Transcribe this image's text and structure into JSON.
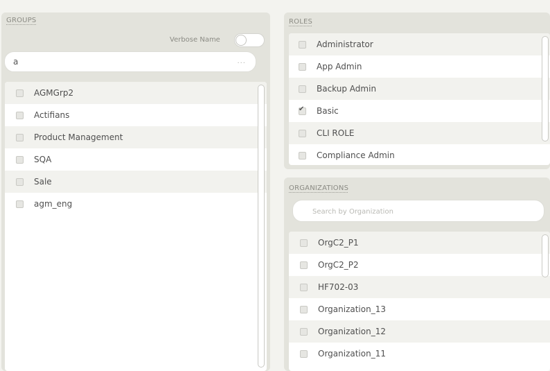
{
  "groups": {
    "title": "GROUPS",
    "verbose_label": "Verbose Name",
    "search": {
      "value": "a",
      "more_indicator": "..."
    },
    "items": [
      {
        "label": "AGMGrp2",
        "checked": false
      },
      {
        "label": "Actifians",
        "checked": false
      },
      {
        "label": "Product Management",
        "checked": false
      },
      {
        "label": "SQA",
        "checked": false
      },
      {
        "label": "Sale",
        "checked": false
      },
      {
        "label": "agm_eng",
        "checked": false
      }
    ]
  },
  "roles": {
    "title": "ROLES",
    "items": [
      {
        "label": "Administrator",
        "checked": false
      },
      {
        "label": "App Admin",
        "checked": false
      },
      {
        "label": "Backup Admin",
        "checked": false
      },
      {
        "label": "Basic",
        "checked": true
      },
      {
        "label": "CLI ROLE",
        "checked": false
      },
      {
        "label": "Compliance Admin",
        "checked": false
      }
    ]
  },
  "organizations": {
    "title": "ORGANIZATIONS",
    "search": {
      "placeholder": "Search by Organization",
      "value": ""
    },
    "items": [
      {
        "label": "OrgC2_P1",
        "checked": false
      },
      {
        "label": "OrgC2_P2",
        "checked": false
      },
      {
        "label": "HF702-03",
        "checked": false
      },
      {
        "label": "Organization_13",
        "checked": false
      },
      {
        "label": "Organization_12",
        "checked": false
      },
      {
        "label": "Organization_11",
        "checked": false
      }
    ]
  },
  "colors": {
    "panel_bg": "#e3e3dc",
    "page_bg": "#f3f3ef",
    "row_alt": "#f2f2ee"
  }
}
